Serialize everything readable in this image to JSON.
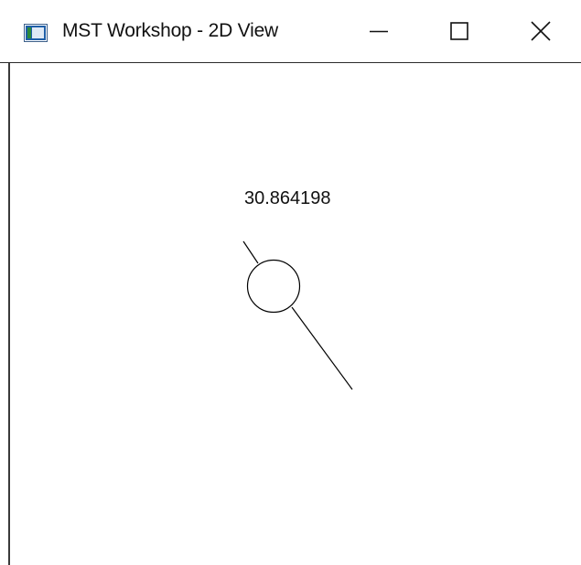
{
  "window": {
    "title": "MST Workshop - 2D View",
    "icon": "app-window-icon",
    "controls": {
      "minimize_icon": "minimize-icon",
      "maximize_icon": "maximize-icon",
      "close_icon": "close-icon"
    }
  },
  "canvas": {
    "value_label": "30.864198"
  }
}
